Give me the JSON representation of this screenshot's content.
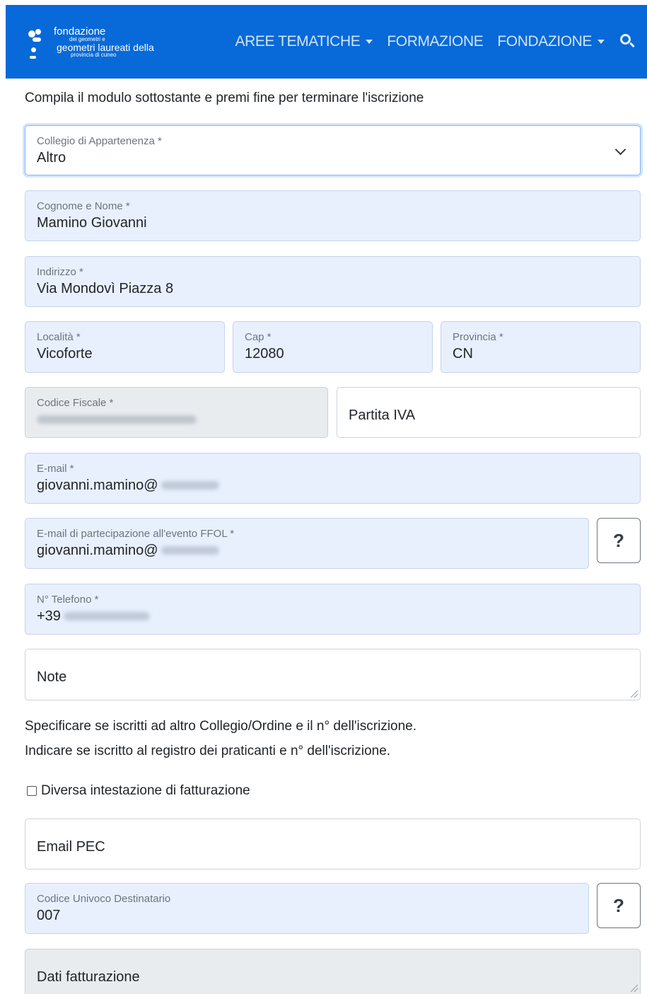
{
  "brand": {
    "line1": "fondazione",
    "line2": "dei geometri e",
    "line3": "geometri laureati della",
    "line4": "provincia di cuneo",
    "color": "#0869d8"
  },
  "nav": {
    "items": [
      {
        "label": "AREE TEMATICHE",
        "dropdown": true
      },
      {
        "label": "FORMAZIONE",
        "dropdown": false
      },
      {
        "label": "FONDAZIONE",
        "dropdown": true
      }
    ],
    "search_icon": "search-icon"
  },
  "form": {
    "intro": "Compila il modulo sottostante e premi fine per terminare l'iscrizione",
    "collegio": {
      "label": "Collegio di Appartenenza *",
      "value": "Altro"
    },
    "nome": {
      "label": "Cognome e Nome *",
      "value": "Mamino Giovanni"
    },
    "indirizzo": {
      "label": "Indirizzo *",
      "value": "Via Mondovì Piazza 8"
    },
    "localita": {
      "label": "Località *",
      "value": "Vicoforte"
    },
    "cap": {
      "label": "Cap *",
      "value": "12080"
    },
    "provincia": {
      "label": "Provincia *",
      "value": "CN"
    },
    "codice_fiscale": {
      "label": "Codice Fiscale *"
    },
    "partita_iva": {
      "placeholder": "Partita IVA"
    },
    "email": {
      "label": "E-mail *",
      "value": "giovanni.mamino@"
    },
    "email_evento": {
      "label": "E-mail di partecipazione all'evento FFOL *",
      "value": "giovanni.mamino@"
    },
    "telefono": {
      "label": "N° Telefono *",
      "value": "+39"
    },
    "note": {
      "placeholder": "Note"
    },
    "help_line1": "Specificare se iscritti ad altro Collegio/Ordine e il n° dell'iscrizione.",
    "help_line2": "Indicare se iscritto al registro dei praticanti e n° dell'iscrizione.",
    "fatturazione_checkbox": {
      "label": "Diversa intestazione di fatturazione",
      "checked": false
    },
    "email_pec": {
      "placeholder": "Email PEC"
    },
    "codice_univoco": {
      "label": "Codice Univoco Destinatario",
      "value": "007"
    },
    "dati_fatturazione": {
      "placeholder": "Dati fatturazione"
    },
    "help_button_label": "?"
  }
}
